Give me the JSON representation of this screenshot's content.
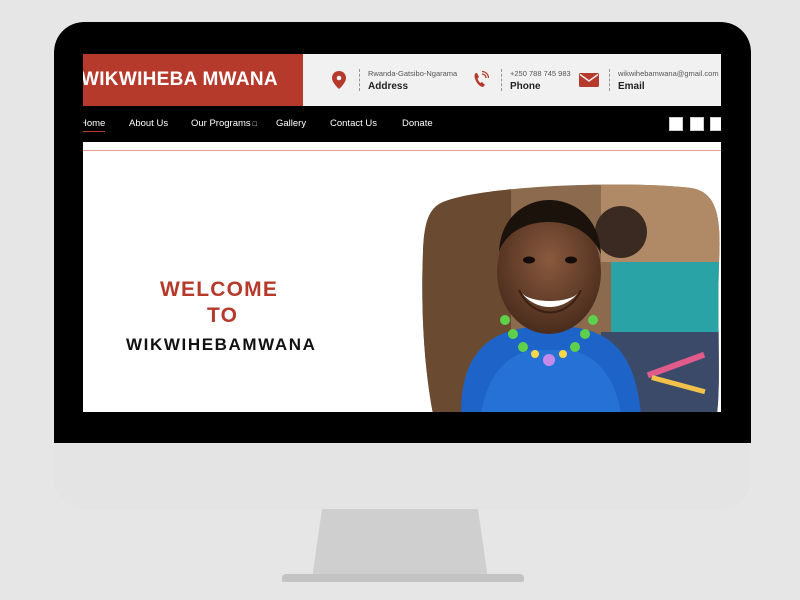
{
  "site": {
    "brand": "WIKWIHEBA MWANA"
  },
  "contacts": [
    {
      "icon": "map-pin-icon",
      "small": "Rwanda-Gatsibo-Ngarama",
      "label": "Address"
    },
    {
      "icon": "phone-icon",
      "small": "+250 788 745 983",
      "label": "Phone"
    },
    {
      "icon": "envelope-icon",
      "small": "wikwihebamwana@gmail.com",
      "label": "Email"
    }
  ],
  "nav": {
    "items": [
      "Home",
      "About Us",
      "Our Programs",
      "Gallery",
      "Contact Us",
      "Donate"
    ],
    "dropdown_glyph": "□"
  },
  "hero": {
    "line1": "WELCOME",
    "line2": "TO",
    "line3": "WIKWIHEBAMWANA"
  },
  "colors": {
    "brand_red": "#b63a2c",
    "nav_bg": "#000000",
    "topbar_bg": "#f1f1f1"
  }
}
